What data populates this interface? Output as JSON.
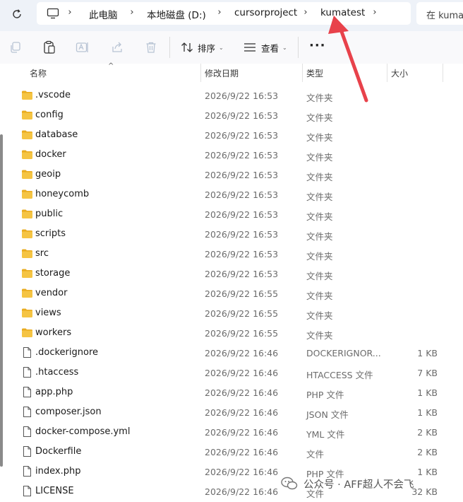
{
  "breadcrumb": [
    "此电脑",
    "本地磁盘 (D:)",
    "cursorproject",
    "kumatest"
  ],
  "search": {
    "placeholder": "在 kumatest 中搜索",
    "visible_text": "在 kuma"
  },
  "toolbar": {
    "sort_label": "排序",
    "view_label": "查看",
    "more_label": "···"
  },
  "columns": {
    "name": "名称",
    "modified": "修改日期",
    "type": "类型",
    "size": "大小"
  },
  "files": [
    {
      "name": ".vscode",
      "modified": "2026/9/22 16:53",
      "type": "文件夹",
      "size": "",
      "kind": "folder"
    },
    {
      "name": "config",
      "modified": "2026/9/22 16:53",
      "type": "文件夹",
      "size": "",
      "kind": "folder"
    },
    {
      "name": "database",
      "modified": "2026/9/22 16:53",
      "type": "文件夹",
      "size": "",
      "kind": "folder"
    },
    {
      "name": "docker",
      "modified": "2026/9/22 16:53",
      "type": "文件夹",
      "size": "",
      "kind": "folder"
    },
    {
      "name": "geoip",
      "modified": "2026/9/22 16:53",
      "type": "文件夹",
      "size": "",
      "kind": "folder"
    },
    {
      "name": "honeycomb",
      "modified": "2026/9/22 16:53",
      "type": "文件夹",
      "size": "",
      "kind": "folder"
    },
    {
      "name": "public",
      "modified": "2026/9/22 16:53",
      "type": "文件夹",
      "size": "",
      "kind": "folder"
    },
    {
      "name": "scripts",
      "modified": "2026/9/22 16:53",
      "type": "文件夹",
      "size": "",
      "kind": "folder"
    },
    {
      "name": "src",
      "modified": "2026/9/22 16:53",
      "type": "文件夹",
      "size": "",
      "kind": "folder"
    },
    {
      "name": "storage",
      "modified": "2026/9/22 16:53",
      "type": "文件夹",
      "size": "",
      "kind": "folder"
    },
    {
      "name": "vendor",
      "modified": "2026/9/22 16:55",
      "type": "文件夹",
      "size": "",
      "kind": "folder"
    },
    {
      "name": "views",
      "modified": "2026/9/22 16:55",
      "type": "文件夹",
      "size": "",
      "kind": "folder"
    },
    {
      "name": "workers",
      "modified": "2026/9/22 16:55",
      "type": "文件夹",
      "size": "",
      "kind": "folder"
    },
    {
      "name": ".dockerignore",
      "modified": "2026/9/22 16:46",
      "type": "DOCKERIGNOR...",
      "size": "1 KB",
      "kind": "file"
    },
    {
      "name": ".htaccess",
      "modified": "2026/9/22 16:46",
      "type": "HTACCESS 文件",
      "size": "7 KB",
      "kind": "file"
    },
    {
      "name": "app.php",
      "modified": "2026/9/22 16:46",
      "type": "PHP 文件",
      "size": "1 KB",
      "kind": "file"
    },
    {
      "name": "composer.json",
      "modified": "2026/9/22 16:46",
      "type": "JSON 文件",
      "size": "1 KB",
      "kind": "file"
    },
    {
      "name": "docker-compose.yml",
      "modified": "2026/9/22 16:46",
      "type": "YML 文件",
      "size": "2 KB",
      "kind": "file"
    },
    {
      "name": "Dockerfile",
      "modified": "2026/9/22 16:46",
      "type": "文件",
      "size": "2 KB",
      "kind": "file"
    },
    {
      "name": "index.php",
      "modified": "2026/9/22 16:46",
      "type": "PHP 文件",
      "size": "1 KB",
      "kind": "file"
    },
    {
      "name": "LICENSE",
      "modified": "2026/9/22 16:46",
      "type": "文件",
      "size": "32 KB",
      "kind": "file"
    }
  ],
  "watermark": {
    "text": "公众号 · AFF超人不会飞"
  },
  "colors": {
    "folder": "#f5c443",
    "folder_dark": "#e9ab1f",
    "annotation_arrow": "#e8424b",
    "topbar_bg": "#eef2f8"
  },
  "icons": {
    "refresh": "refresh-icon",
    "computer": "computer-icon",
    "copy": "copy-icon",
    "paste": "paste-icon",
    "rename": "rename-icon",
    "share": "share-icon",
    "delete": "trash-icon",
    "sort": "sort-icon",
    "view": "view-icon"
  }
}
